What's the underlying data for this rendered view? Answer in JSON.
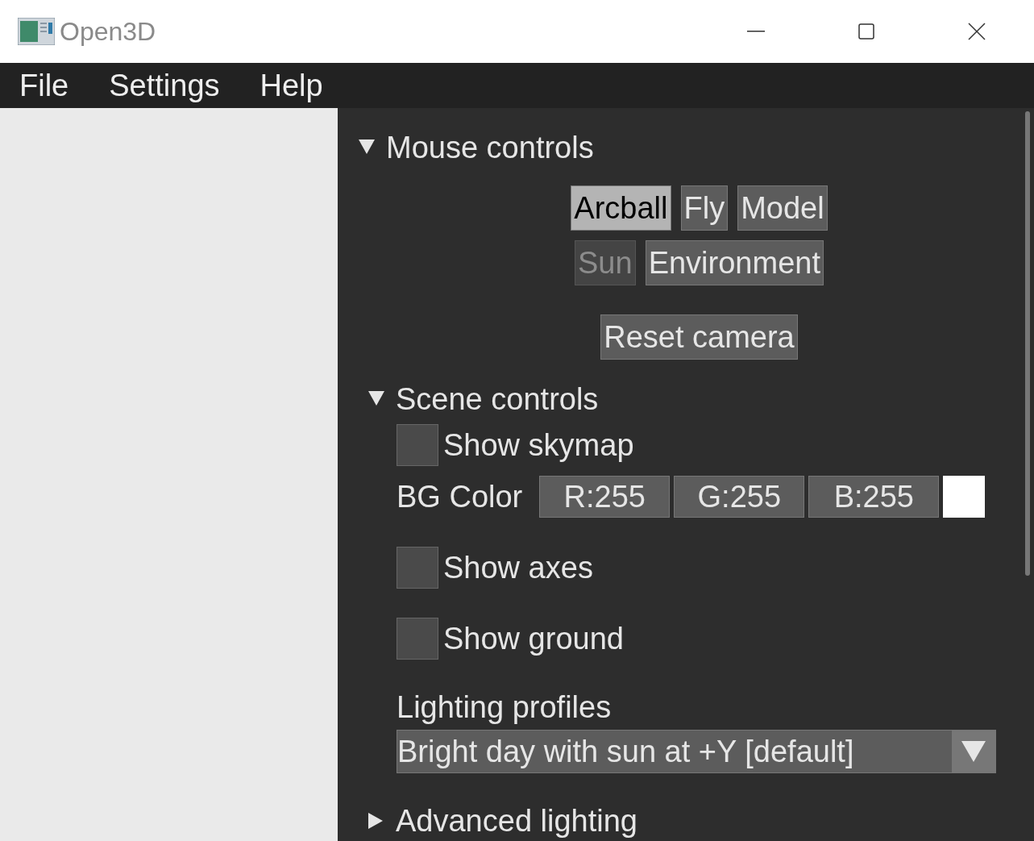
{
  "window": {
    "title": "Open3D"
  },
  "menu": [
    {
      "label": "File"
    },
    {
      "label": "Settings"
    },
    {
      "label": "Help"
    }
  ],
  "mouse_controls": {
    "title": "Mouse controls",
    "expanded": true,
    "modes": [
      [
        {
          "label": "Arcball",
          "selected": true,
          "disabled": false
        },
        {
          "label": "Fly",
          "selected": false,
          "disabled": false
        },
        {
          "label": "Model",
          "selected": false,
          "disabled": false
        }
      ],
      [
        {
          "label": "Sun",
          "selected": false,
          "disabled": true
        },
        {
          "label": "Environment",
          "selected": false,
          "disabled": false
        }
      ]
    ],
    "reset_button": "Reset camera"
  },
  "scene_controls": {
    "title": "Scene controls",
    "expanded": true,
    "show_skymap": {
      "label": "Show skymap",
      "checked": false
    },
    "bg_color": {
      "label": "BG Color",
      "fields": [
        "R:255",
        "G:255",
        "B:255"
      ],
      "color": "#ffffff"
    },
    "show_axes": {
      "label": "Show axes",
      "checked": false
    },
    "show_ground": {
      "label": "Show ground",
      "checked": false
    },
    "lighting_profiles": {
      "label": "Lighting profiles",
      "value": "Bright day with sun at +Y [default]"
    }
  },
  "advanced_lighting": {
    "title": "Advanced lighting",
    "expanded": false
  }
}
